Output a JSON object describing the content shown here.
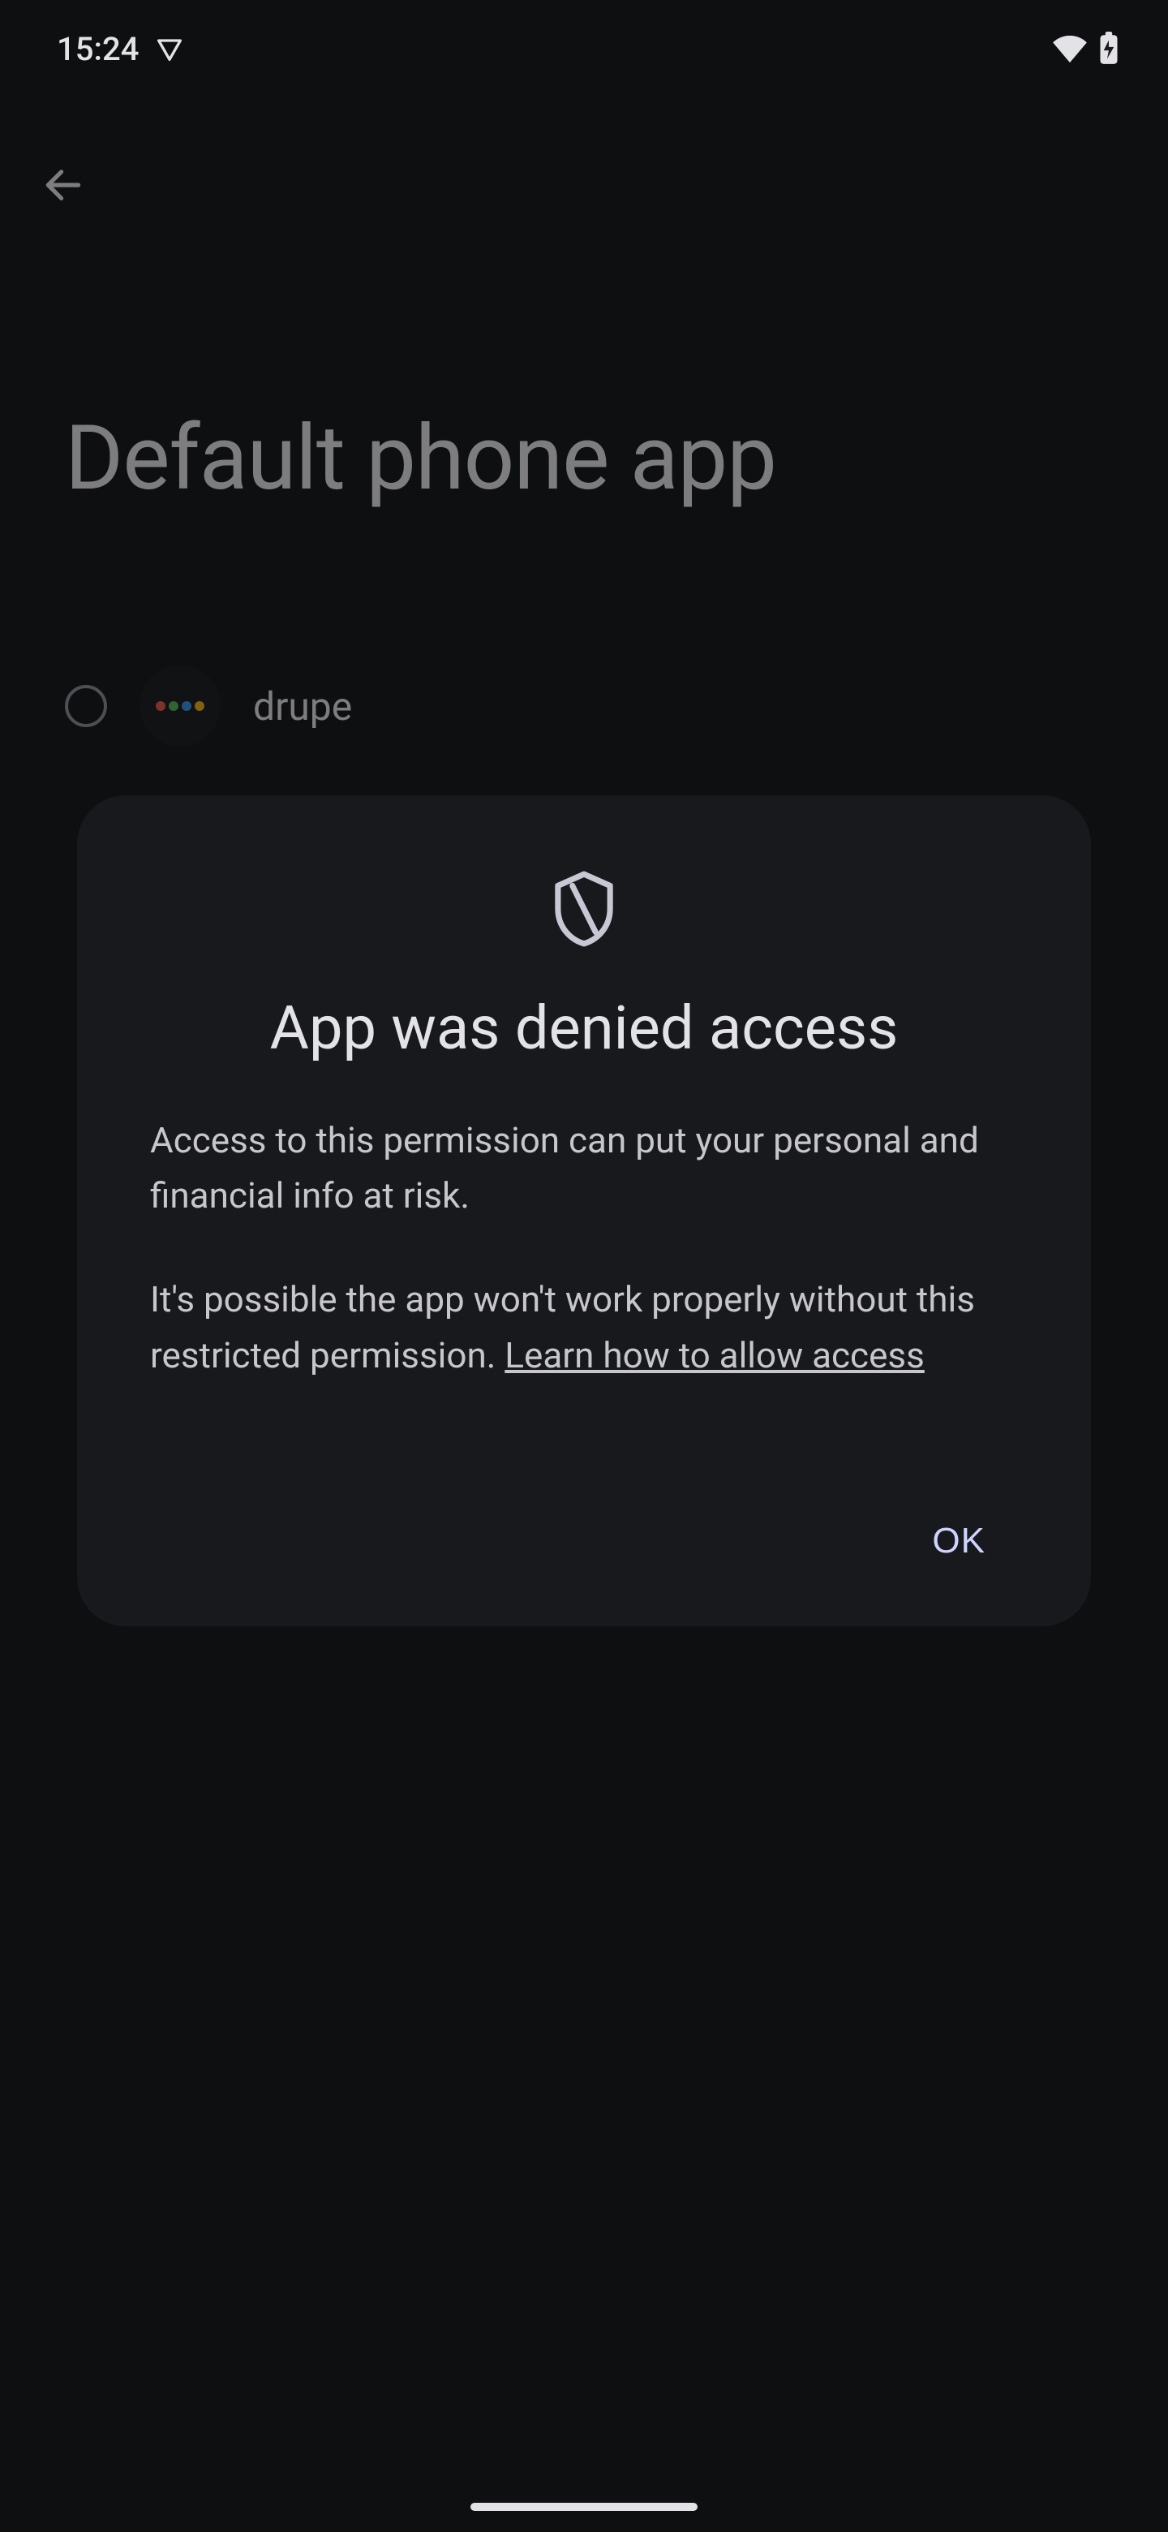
{
  "status_bar": {
    "time": "15:24",
    "icons": {
      "left_extra_icon": "triangle-down-icon",
      "wifi_icon": "wifi-icon",
      "battery_icon": "battery-charging-icon"
    }
  },
  "background_page": {
    "back_icon": "back-arrow-icon",
    "title": "Default phone app",
    "apps": [
      {
        "selected": false,
        "icon": "drupe-app-icon",
        "label": "drupe"
      }
    ]
  },
  "dialog": {
    "icon": "shield-outline-icon",
    "title": "App was denied access",
    "body_para1": "Access to this permission can put your personal and financial info at risk.",
    "body_para2_prefix": "It's possible the app won't work properly without this restricted permission. ",
    "body_para2_link": "Learn how to allow access",
    "ok_label": "OK"
  },
  "gesture_bar": {
    "icon": "gesture-bar"
  }
}
